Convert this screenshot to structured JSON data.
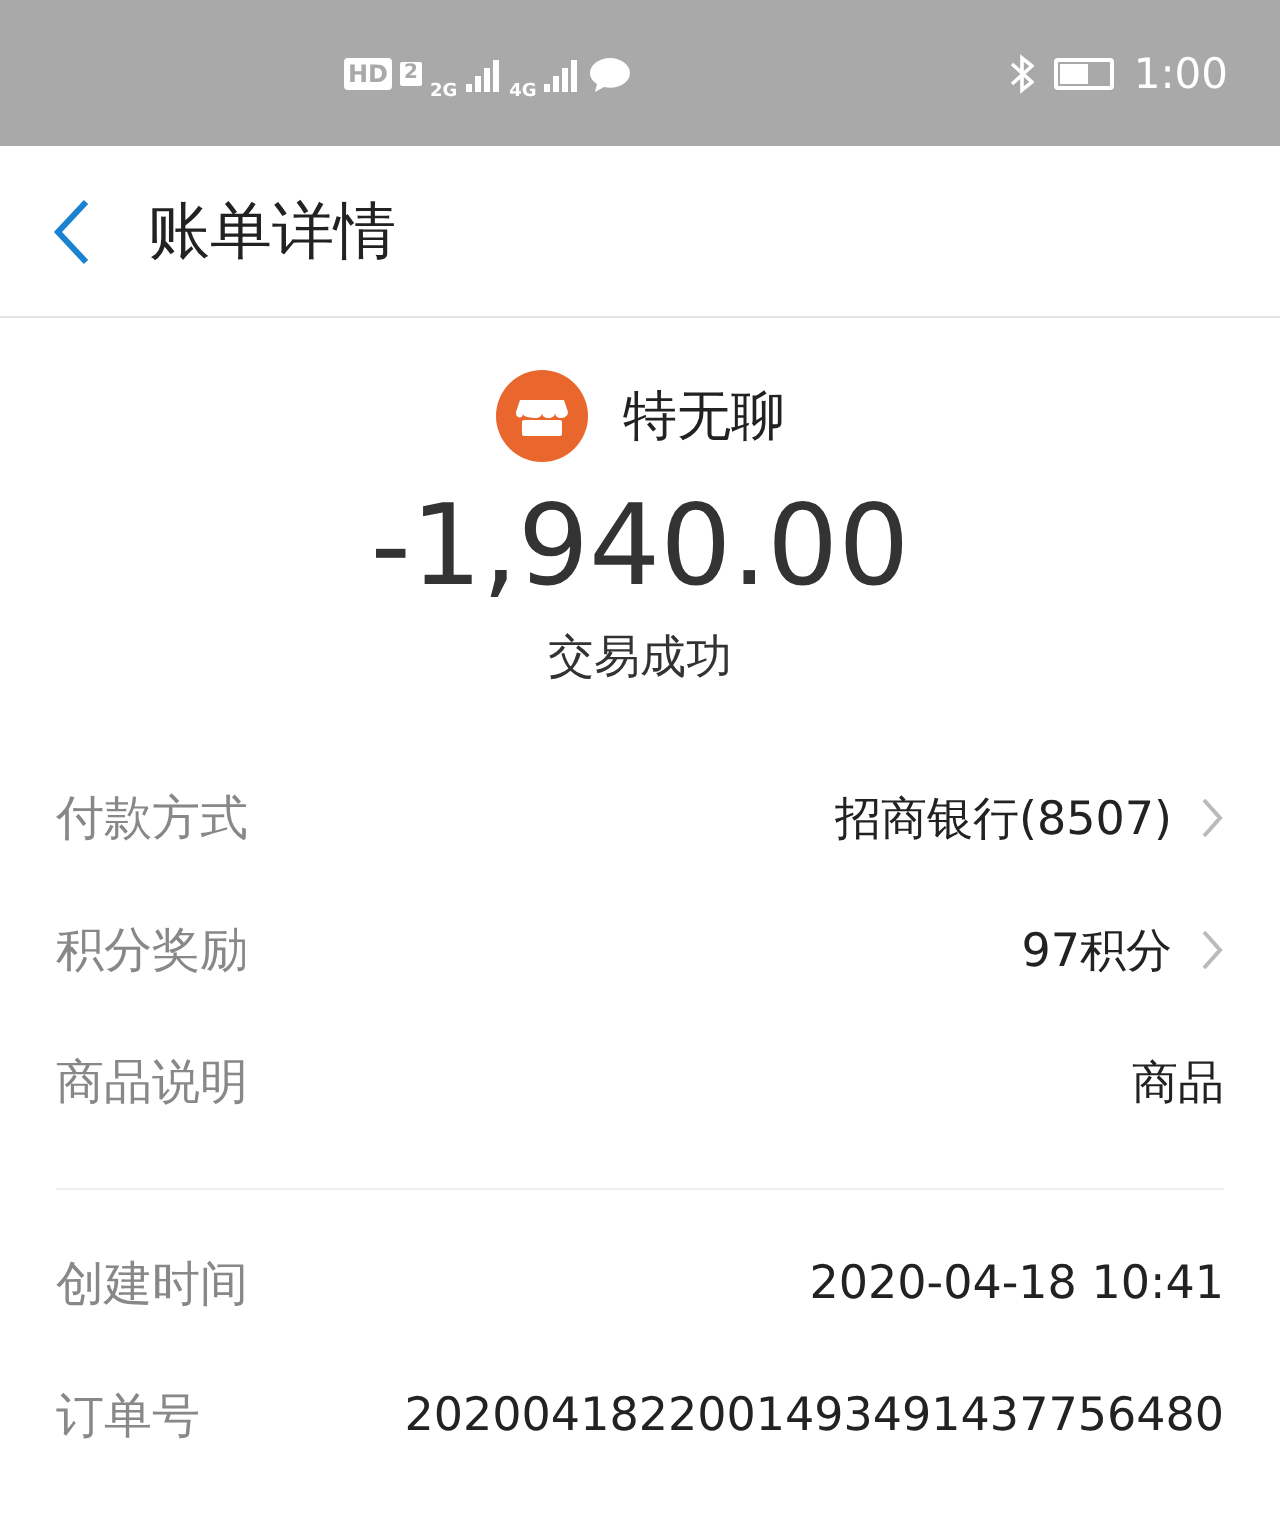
{
  "status_bar": {
    "hd": "HD",
    "sim": "2",
    "net1": "2G",
    "net2": "4G",
    "time": "1:00"
  },
  "header": {
    "title": "账单详情"
  },
  "merchant": {
    "name": "特无聊",
    "amount": "-1,940.00",
    "status": "交易成功"
  },
  "groups": [
    [
      {
        "label": "付款方式",
        "value": "招商银行(8507)",
        "has_arrow": true
      },
      {
        "label": "积分奖励",
        "value": "97积分",
        "has_arrow": true
      },
      {
        "label": "商品说明",
        "value": "商品",
        "has_arrow": false
      }
    ],
    [
      {
        "label": "创建时间",
        "value": "2020-04-18 10:41",
        "has_arrow": false
      },
      {
        "label": "订单号",
        "value": "2020041822001493491437756480",
        "has_arrow": false
      }
    ]
  ]
}
